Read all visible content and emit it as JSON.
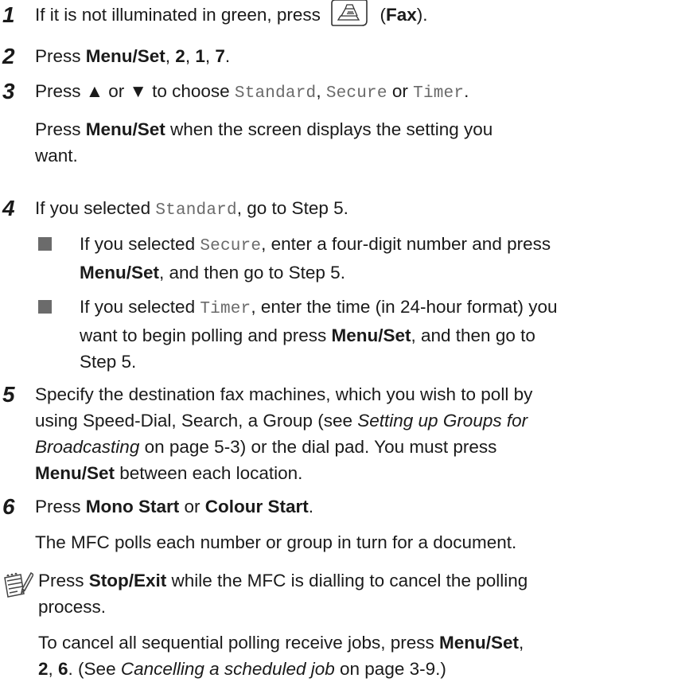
{
  "steps": {
    "s1": {
      "num": "1",
      "a": "If it is not illuminated in green, press",
      "b": "(",
      "fax": "Fax",
      "c": ")."
    },
    "s2": {
      "num": "2",
      "a": "Press ",
      "menu": "Menu/Set",
      "b": ", ",
      "k1": "2",
      "c": ", ",
      "k2": "1",
      "d": ", ",
      "k3": "7",
      "e": "."
    },
    "s3": {
      "num": "3",
      "a": "Press ▲ or ▼ to choose ",
      "m1": "Standard",
      "b": ", ",
      "m2": "Secure",
      "c": " or ",
      "m3": "Timer",
      "d": ".",
      "p2a": "Press ",
      "p2menu": "Menu/Set",
      "p2b": " when the screen displays the setting you",
      "p2c": "want."
    },
    "s4": {
      "num": "4",
      "a": "If you selected ",
      "m1": "Standard",
      "b": ", go to Step 5.",
      "bullet1": {
        "a": "If you selected ",
        "m": "Secure",
        "b": ", enter a four-digit number and press",
        "menu": "Menu/Set",
        "c": ", and then go to Step 5."
      },
      "bullet2": {
        "a": "If you selected ",
        "m": "Timer",
        "b": ", enter the time (in 24-hour format) you",
        "c": "want to begin polling and press ",
        "menu": "Menu/Set",
        "d": ", and then go to",
        "e": "Step 5."
      }
    },
    "s5": {
      "num": "5",
      "l1": "Specify the destination fax machines, which you wish to poll by",
      "l2a": "using Speed-Dial, Search, a Group (see ",
      "l2i": "Setting up Groups for",
      "l3i": "Broadcasting",
      "l3b": " on page 5-3) or the dial pad. You must press",
      "l4menu": "Menu/Set",
      "l4b": " between each location."
    },
    "s6": {
      "num": "6",
      "a": "Press ",
      "mono": "Mono Start",
      "b": " or ",
      "colour": "Colour Start",
      "c": ".",
      "p2": "The MFC polls each number or group in turn for a document."
    }
  },
  "note": {
    "a": "Press ",
    "stop": "Stop/Exit",
    "b": " while the MFC is dialling to cancel the polling",
    "c": "process.",
    "d": "To cancel all sequential polling receive jobs, press ",
    "menu": "Menu/Set",
    "e": ",",
    "k1": "2",
    "f": ", ",
    "k2": "6",
    "g": ". (See ",
    "i": "Cancelling a scheduled job",
    "h": " on page 3-9.)"
  },
  "icons": {
    "fax_button": "fax-machine-icon",
    "note": "notepad-pencil-icon"
  }
}
